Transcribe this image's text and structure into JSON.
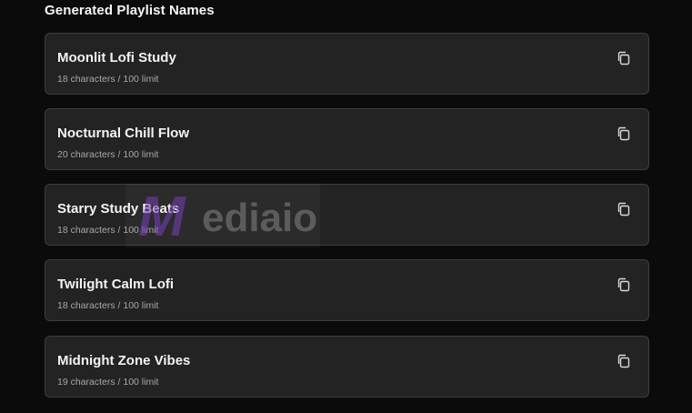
{
  "header": {
    "title": "Generated Playlist Names"
  },
  "playlists": [
    {
      "name": "Moonlit Lofi Study",
      "meta": "18 characters / 100 limit"
    },
    {
      "name": "Nocturnal Chill Flow",
      "meta": "20 characters / 100 limit"
    },
    {
      "name": "Starry Study Beats",
      "meta": "18 characters / 100 limit"
    },
    {
      "name": "Twilight Calm Lofi",
      "meta": "18 characters / 100 limit"
    },
    {
      "name": "Midnight Zone Vibes",
      "meta": "19 characters / 100 limit"
    }
  ],
  "icons": {
    "copy": "copy-icon"
  },
  "watermark": {
    "text": "ediaio",
    "logo_letter": "M",
    "logo_color": "#7a3fb8"
  }
}
